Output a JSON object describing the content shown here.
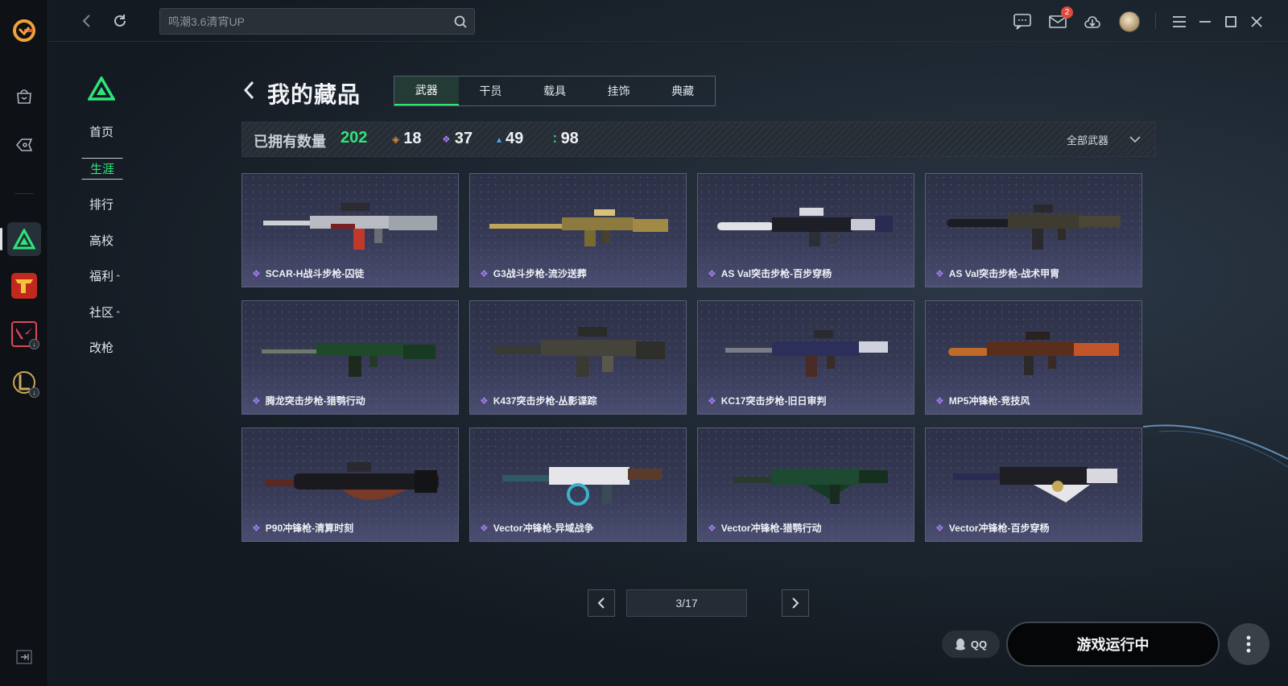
{
  "search": {
    "placeholder": "鸣潮3.6清宵UP"
  },
  "topbar": {
    "mail_badge": "2"
  },
  "subnav": {
    "items": [
      {
        "label": "首页"
      },
      {
        "label": "生涯"
      },
      {
        "label": "排行"
      },
      {
        "label": "高校"
      },
      {
        "label": "福利"
      },
      {
        "label": "社区"
      },
      {
        "label": "改枪"
      }
    ],
    "caret": "⌃"
  },
  "page": {
    "title": "我的藏品"
  },
  "tabs": [
    {
      "label": "武器"
    },
    {
      "label": "干员"
    },
    {
      "label": "载具"
    },
    {
      "label": "挂饰"
    },
    {
      "label": "典藏"
    }
  ],
  "stats": {
    "owned_label": "已拥有数量",
    "total": "202",
    "counts": [
      {
        "value": "18",
        "color": "#e08a3c",
        "icon": "diamond-orange"
      },
      {
        "value": "37",
        "color": "#a37cf0",
        "icon": "diamond-purple"
      },
      {
        "value": "49",
        "color": "#4aa7e8",
        "icon": "triangle-blue"
      },
      {
        "value": "98",
        "color": "#2ee57a",
        "icon": "dots-green"
      }
    ],
    "filter_label": "全部武器"
  },
  "items": [
    {
      "name": "SCAR-H战斗步枪-囚徒"
    },
    {
      "name": "G3战斗步枪-流沙送葬"
    },
    {
      "name": "AS Val突击步枪-百步穿杨"
    },
    {
      "name": "AS Val突击步枪-战术甲胄"
    },
    {
      "name": "腾龙突击步枪-猎鹗行动"
    },
    {
      "name": "K437突击步枪-丛影谍踪"
    },
    {
      "name": "KC17突击步枪-旧日审判"
    },
    {
      "name": "MP5冲锋枪-竞技风"
    },
    {
      "name": "P90冲锋枪-清算时刻"
    },
    {
      "name": "Vector冲锋枪-异域战争"
    },
    {
      "name": "Vector冲锋枪-猎鹗行动"
    },
    {
      "name": "Vector冲锋枪-百步穿杨"
    }
  ],
  "pager": {
    "text": "3/17"
  },
  "bottom": {
    "qq_label": "QQ",
    "run_label": "游戏运行中"
  },
  "colors": {
    "accent": "#2ee57a",
    "purple_rarity": "#a37cf0"
  }
}
